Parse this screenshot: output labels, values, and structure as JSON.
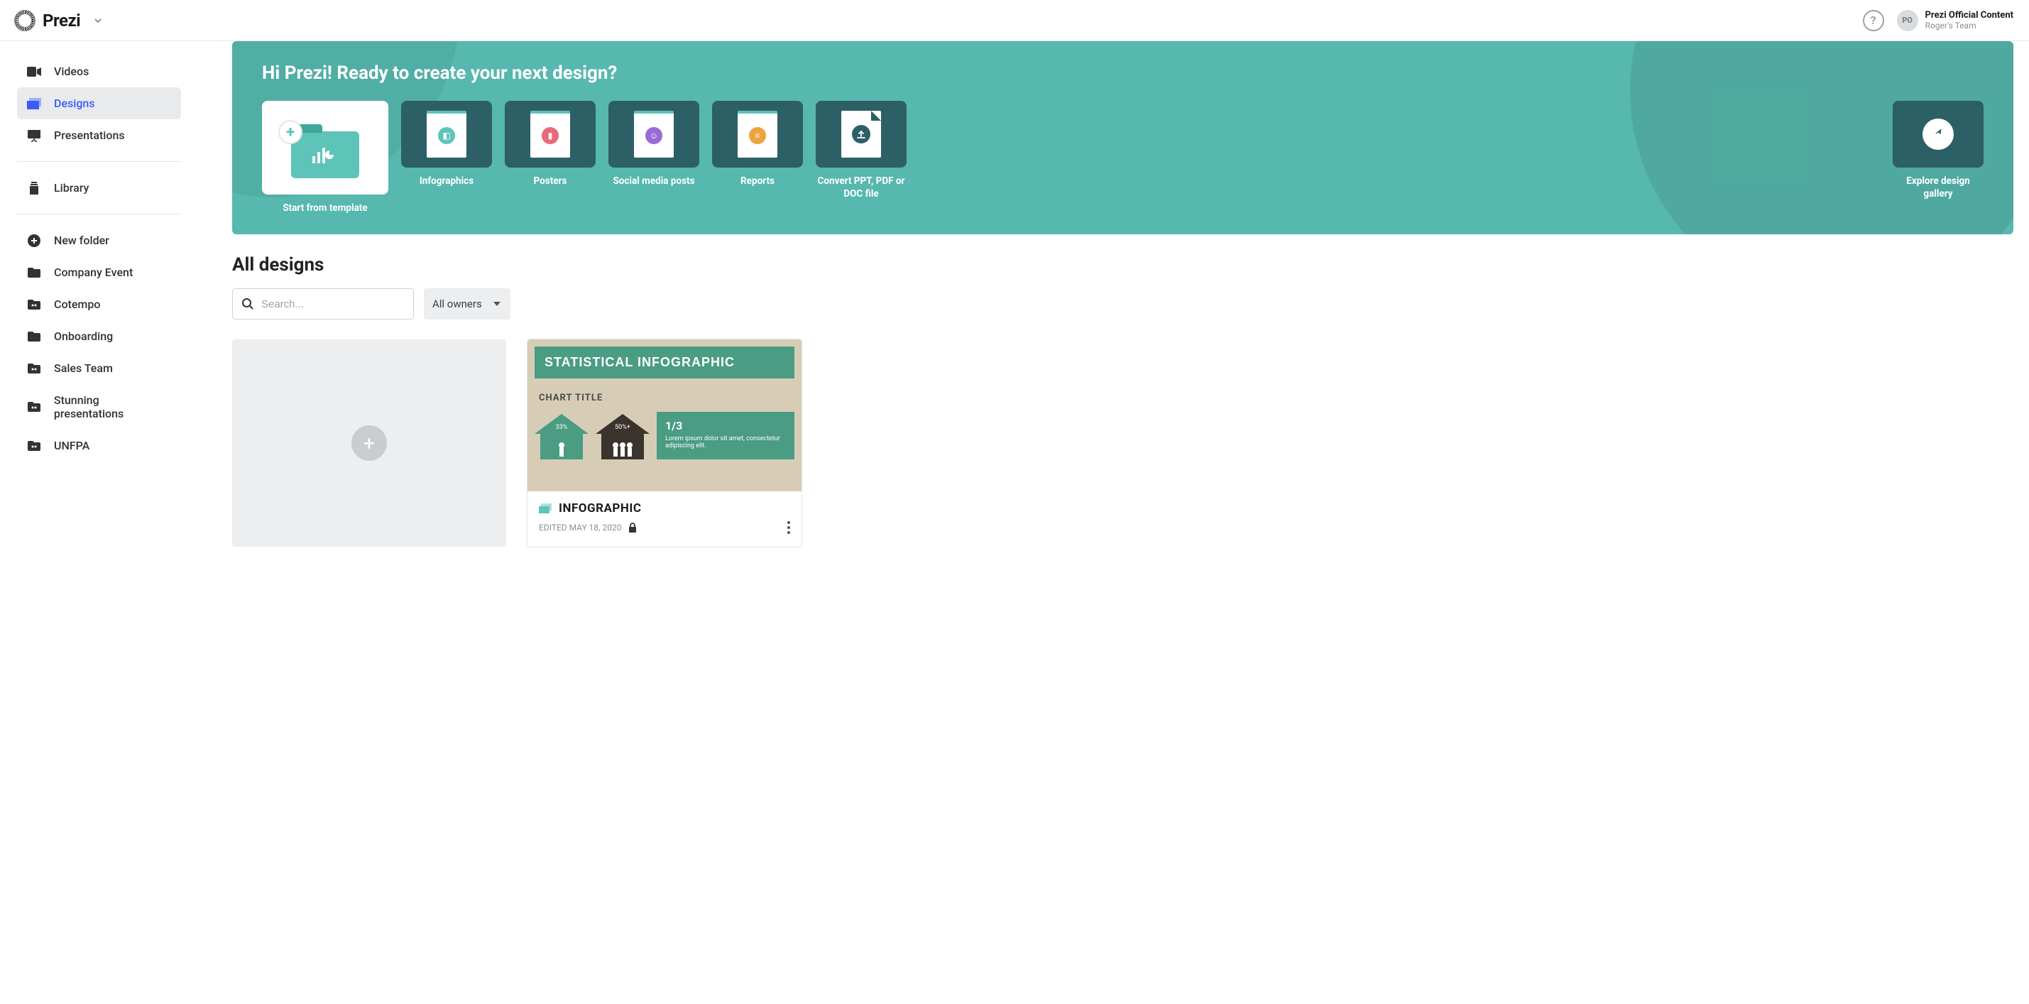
{
  "header": {
    "brand": "Prezi",
    "help_tooltip": "?",
    "user_initials": "PO",
    "user_name": "Prezi Official Content",
    "user_team": "Roger's Team"
  },
  "sidebar": {
    "primary": [
      {
        "icon": "video-icon",
        "label": "Videos"
      },
      {
        "icon": "designs-icon",
        "label": "Designs"
      },
      {
        "icon": "presentations-icon",
        "label": "Presentations"
      }
    ],
    "library_label": "Library",
    "new_folder_label": "New folder",
    "folders": [
      "Company Event",
      "Cotempo",
      "Onboarding",
      "Sales Team",
      "Stunning presentations",
      "UNFPA"
    ]
  },
  "hero": {
    "greeting": "Hi Prezi! Ready to create your next design?",
    "tiles": [
      {
        "label": "Start from template"
      },
      {
        "label": "Infographics"
      },
      {
        "label": "Posters"
      },
      {
        "label": "Social media posts"
      },
      {
        "label": "Reports"
      },
      {
        "label": "Convert PPT, PDF or DOC file"
      },
      {
        "label": "Explore design gallery"
      }
    ]
  },
  "section": {
    "title": "All designs",
    "search_placeholder": "Search...",
    "owner_filter": "All owners"
  },
  "designs": [
    {
      "banner": "STATISTICAL INFOGRAPHIC",
      "chart_label": "CHART TITLE",
      "house1": "33%",
      "house2": "50%+",
      "stat_big": "1/3",
      "stat_text": "Lorem ipsum dolor sit amet, consectetur adipiscing elit.",
      "title": "INFOGRAPHIC",
      "edited": "EDITED MAY 18, 2020"
    }
  ]
}
